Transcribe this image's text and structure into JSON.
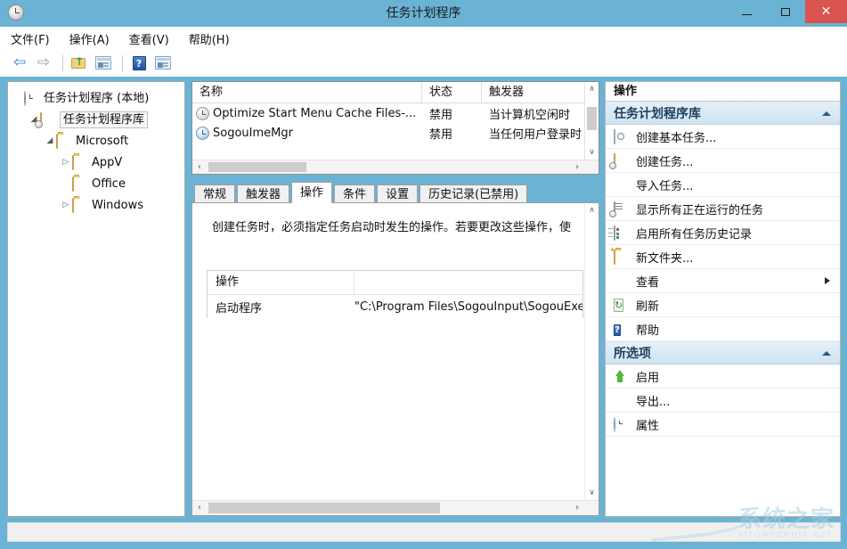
{
  "window": {
    "title": "任务计划程序",
    "icon": "clock-icon",
    "minimize_label": "–",
    "maximize_label": "□",
    "close_label": "✕",
    "accent_color": "#6ab3d4",
    "close_color": "#d9534f"
  },
  "menubar": {
    "items": [
      {
        "label": "文件(F)",
        "name": "menu-file"
      },
      {
        "label": "操作(A)",
        "name": "menu-action"
      },
      {
        "label": "查看(V)",
        "name": "menu-view"
      },
      {
        "label": "帮助(H)",
        "name": "menu-help"
      }
    ]
  },
  "toolbar": {
    "buttons": [
      {
        "name": "back-button",
        "icon": "arrow-left-icon",
        "glyph": "⇦"
      },
      {
        "name": "forward-button",
        "icon": "arrow-right-icon",
        "glyph": "⇨"
      },
      {
        "name": "up-folder-button",
        "icon": "folder-up-icon"
      },
      {
        "name": "show-hide-console-tree-button",
        "icon": "console-tree-icon"
      },
      {
        "name": "help-button",
        "icon": "help-icon",
        "glyph": "?"
      },
      {
        "name": "show-action-pane-button",
        "icon": "action-pane-icon"
      }
    ]
  },
  "tree": {
    "items": [
      {
        "label": "任务计划程序 (本地)",
        "icon": "clock-icon",
        "twisty": "",
        "indent": 1,
        "selected": false
      },
      {
        "label": "任务计划程序库",
        "icon": "library-folder-icon",
        "twisty": "◢",
        "indent": 2,
        "selected": true
      },
      {
        "label": "Microsoft",
        "icon": "folder-icon",
        "twisty": "◢",
        "indent": 3,
        "selected": false
      },
      {
        "label": "AppV",
        "icon": "folder-icon",
        "twisty": "▷",
        "indent": 4,
        "selected": false
      },
      {
        "label": "Office",
        "icon": "folder-icon",
        "twisty": "",
        "indent": 4,
        "selected": false
      },
      {
        "label": "Windows",
        "icon": "folder-icon",
        "twisty": "▷",
        "indent": 4,
        "selected": false
      }
    ]
  },
  "task_list": {
    "columns": [
      "名称",
      "状态",
      "触发器"
    ],
    "rows": [
      {
        "name": "Optimize Start Menu Cache Files-...",
        "status": "禁用",
        "trigger": "当计算机空闲时",
        "icon": "task-clock-gray-icon"
      },
      {
        "name": "SogouImeMgr",
        "status": "禁用",
        "trigger": "当任何用户登录时",
        "icon": "task-clock-blue-icon"
      }
    ],
    "scroll": {
      "up_glyph": "∧",
      "down_glyph": "∨",
      "left_glyph": "‹",
      "right_glyph": "›"
    }
  },
  "detail": {
    "tabs": [
      {
        "label": "常规",
        "name": "tab-general",
        "active": false
      },
      {
        "label": "触发器",
        "name": "tab-triggers",
        "active": false
      },
      {
        "label": "操作",
        "name": "tab-actions",
        "active": true
      },
      {
        "label": "条件",
        "name": "tab-conditions",
        "active": false
      },
      {
        "label": "设置",
        "name": "tab-settings",
        "active": false
      },
      {
        "label": "历史记录(已禁用)",
        "name": "tab-history",
        "active": false
      }
    ],
    "description": "创建任务时，必须指定任务启动时发生的操作。若要更改这些操作，使",
    "action_table": {
      "headers": [
        "操作",
        ""
      ],
      "rows": [
        {
          "action": "启动程序",
          "details": "\"C:\\Program Files\\SogouInput\\SogouExe\\S"
        }
      ]
    },
    "scroll": {
      "up_glyph": "∧",
      "down_glyph": "∨",
      "left_glyph": "‹",
      "right_glyph": "›"
    }
  },
  "actions_pane": {
    "title": "操作",
    "groups": [
      {
        "header": "任务计划程序库",
        "name": "actions-group-library",
        "collapse_glyph": "▲",
        "items": [
          {
            "label": "创建基本任务...",
            "icon": "create-basic-task-icon",
            "name": "action-create-basic-task",
            "submenu": false
          },
          {
            "label": "创建任务...",
            "icon": "create-task-icon",
            "name": "action-create-task",
            "submenu": false
          },
          {
            "label": "导入任务...",
            "icon": "",
            "name": "action-import-task",
            "submenu": false
          },
          {
            "label": "显示所有正在运行的任务",
            "icon": "running-tasks-icon",
            "name": "action-show-running-tasks",
            "submenu": false
          },
          {
            "label": "启用所有任务历史记录",
            "icon": "task-history-icon",
            "name": "action-enable-task-history",
            "submenu": false
          },
          {
            "label": "新文件夹...",
            "icon": "new-folder-icon",
            "name": "action-new-folder",
            "submenu": false
          },
          {
            "label": "查看",
            "icon": "",
            "name": "action-view",
            "submenu": true
          },
          {
            "label": "刷新",
            "icon": "refresh-icon",
            "name": "action-refresh",
            "submenu": false
          },
          {
            "label": "帮助",
            "icon": "help-icon",
            "name": "action-help",
            "submenu": false
          }
        ]
      },
      {
        "header": "所选项",
        "name": "actions-group-selected-item",
        "collapse_glyph": "▲",
        "items": [
          {
            "label": "启用",
            "icon": "enable-arrow-icon",
            "name": "action-enable",
            "submenu": false
          },
          {
            "label": "导出...",
            "icon": "",
            "name": "action-export",
            "submenu": false
          },
          {
            "label": "属性",
            "icon": "properties-clock-icon",
            "name": "action-properties",
            "submenu": false
          }
        ]
      }
    ]
  },
  "watermark": {
    "text": "系统之家",
    "subtext": "XITONGZHIJIA.NET"
  }
}
